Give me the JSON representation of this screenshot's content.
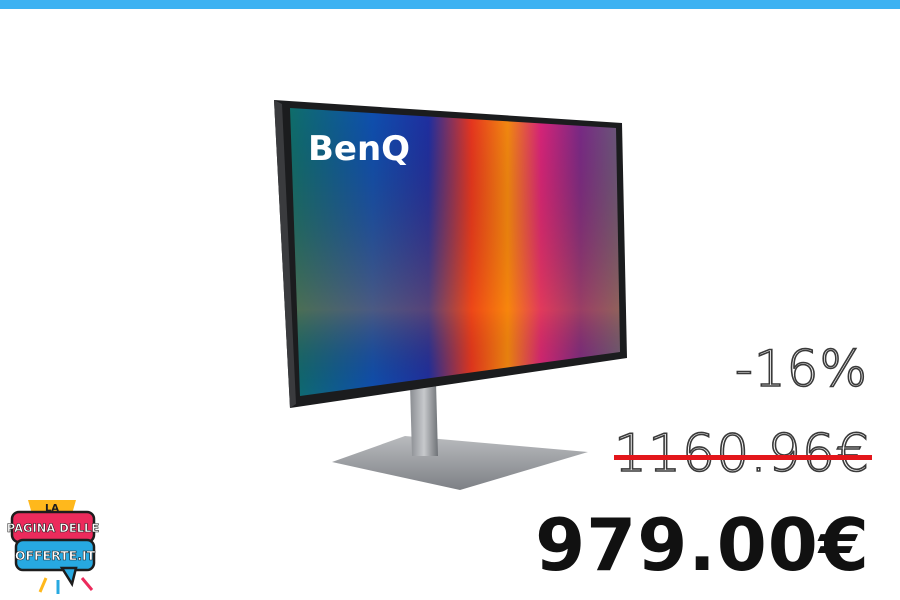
{
  "product": {
    "brand_on_screen": "BenQ"
  },
  "pricing": {
    "discount": "-16%",
    "old_price": "1160.96€",
    "new_price": "979.00€"
  },
  "logo": {
    "line1": "LA",
    "line2": "PAGINA DELLE",
    "line3": "OFFERTE.IT"
  },
  "colors": {
    "top_bar": "#3db2f2",
    "strike": "#e3161b"
  }
}
